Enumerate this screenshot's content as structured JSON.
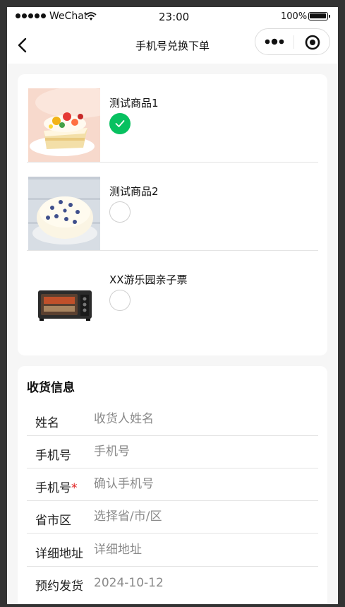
{
  "status_bar": {
    "carrier": "WeChat",
    "time": "23:00",
    "battery": "100%"
  },
  "nav": {
    "title": "手机号兑换下单"
  },
  "products": [
    {
      "name": "测试商品1",
      "selected": true
    },
    {
      "name": "测试商品2",
      "selected": false
    },
    {
      "name": "XX游乐园亲子票",
      "selected": false
    }
  ],
  "shipping": {
    "title": "收货信息",
    "fields": {
      "name": {
        "label": "姓名",
        "placeholder": "收货人姓名"
      },
      "phone": {
        "label": "手机号",
        "placeholder": "手机号"
      },
      "confirm_phone": {
        "label": "手机号",
        "required_mark": "*",
        "placeholder": "确认手机号"
      },
      "region": {
        "label": "省市区",
        "placeholder": "选择省/市/区"
      },
      "address": {
        "label": "详细地址",
        "placeholder": "详细地址"
      },
      "ship_date": {
        "label": "预约发货",
        "value": "2024-10-12"
      }
    }
  },
  "colors": {
    "accent_green": "#07c160",
    "required_red": "#e02020"
  }
}
